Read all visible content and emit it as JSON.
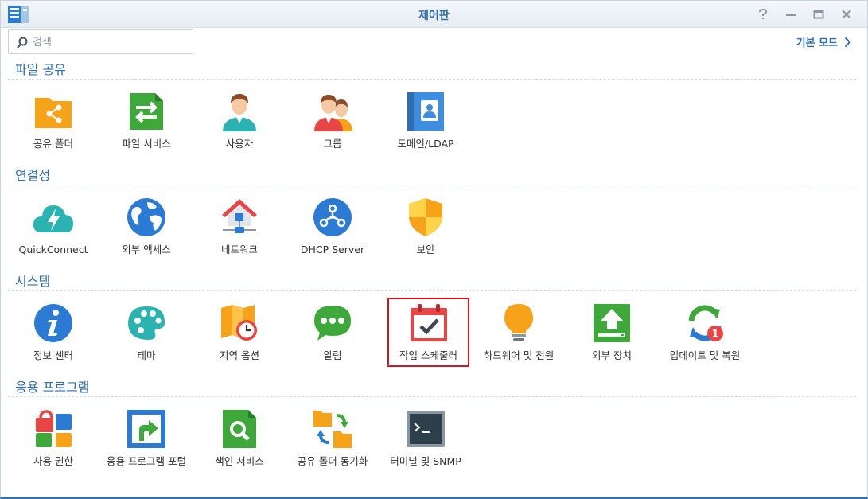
{
  "window": {
    "title": "제어판",
    "controls": [
      "help-icon",
      "minimize-icon",
      "maximize-icon",
      "close-icon"
    ]
  },
  "search": {
    "placeholder": "검색",
    "value": ""
  },
  "mode_link": {
    "label": "기본 모드"
  },
  "sections": [
    {
      "title": "파일 공유",
      "items": [
        {
          "label": "공유 폴더",
          "icon": "shared-folder-icon"
        },
        {
          "label": "파일 서비스",
          "icon": "file-services-icon"
        },
        {
          "label": "사용자",
          "icon": "user-icon"
        },
        {
          "label": "그룹",
          "icon": "group-icon"
        },
        {
          "label": "도메인/LDAP",
          "icon": "domain-ldap-icon"
        }
      ]
    },
    {
      "title": "연결성",
      "items": [
        {
          "label": "QuickConnect",
          "icon": "quickconnect-icon"
        },
        {
          "label": "외부 액세스",
          "icon": "external-access-icon"
        },
        {
          "label": "네트워크",
          "icon": "network-icon"
        },
        {
          "label": "DHCP Server",
          "icon": "dhcp-server-icon"
        },
        {
          "label": "보안",
          "icon": "security-icon"
        }
      ]
    },
    {
      "title": "시스템",
      "items": [
        {
          "label": "정보 센터",
          "icon": "info-center-icon"
        },
        {
          "label": "테마",
          "icon": "theme-icon"
        },
        {
          "label": "지역 옵션",
          "icon": "regional-options-icon"
        },
        {
          "label": "알림",
          "icon": "notification-icon"
        },
        {
          "label": "작업 스케줄러",
          "icon": "task-scheduler-icon",
          "selected": true
        },
        {
          "label": "하드웨어 및 전원",
          "icon": "hardware-power-icon"
        },
        {
          "label": "외부 장치",
          "icon": "external-devices-icon"
        },
        {
          "label": "업데이트 및 복원",
          "icon": "update-restore-icon",
          "badge": "1"
        }
      ]
    },
    {
      "title": "응용 프로그램",
      "items": [
        {
          "label": "사용 권한",
          "icon": "privileges-icon"
        },
        {
          "label": "응용 프로그램 포털",
          "icon": "application-portal-icon"
        },
        {
          "label": "색인 서비스",
          "icon": "indexing-service-icon"
        },
        {
          "label": "공유 폴더 동기화",
          "icon": "shared-folder-sync-icon"
        },
        {
          "label": "터미널 및 SNMP",
          "icon": "terminal-snmp-icon"
        }
      ]
    }
  ],
  "colors": {
    "accent": "#2f6eb0",
    "selection_border": "#e0111b"
  }
}
